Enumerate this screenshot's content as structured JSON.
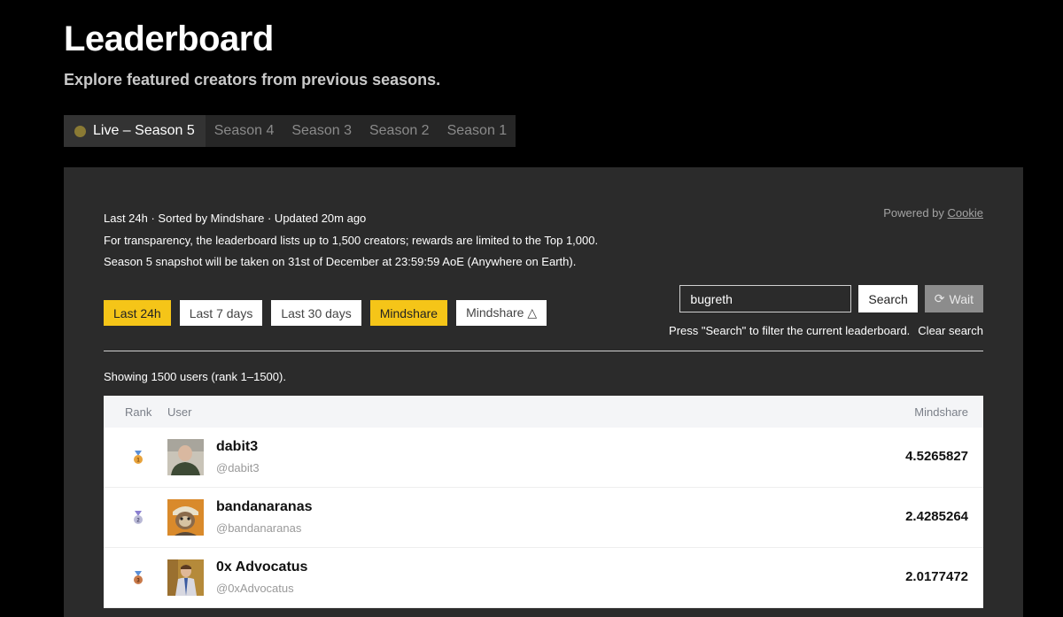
{
  "header": {
    "title": "Leaderboard",
    "subtitle": "Explore featured creators from previous seasons."
  },
  "season_tabs": [
    {
      "label": "Live – Season 5",
      "active": true
    },
    {
      "label": "Season 4",
      "active": false
    },
    {
      "label": "Season 3",
      "active": false
    },
    {
      "label": "Season 2",
      "active": false
    },
    {
      "label": "Season 1",
      "active": false
    }
  ],
  "info": {
    "line1": "Last 24h · Sorted by Mindshare · Updated 20m ago",
    "line2": "For transparency, the leaderboard lists up to 1,500 creators; rewards are limited to the Top 1,000.",
    "line3": "Season 5 snapshot will be taken on 31st of December at 23:59:59 AoE (Anywhere on Earth).",
    "powered_by_prefix": "Powered by",
    "powered_by_link": "Cookie"
  },
  "filters": [
    {
      "label": "Last 24h",
      "active": true
    },
    {
      "label": "Last 7 days",
      "active": false
    },
    {
      "label": "Last 30 days",
      "active": false
    },
    {
      "label": "Mindshare",
      "active": true
    },
    {
      "label": "Mindshare △",
      "active": false
    }
  ],
  "search": {
    "value": "bugreth",
    "button_label": "Search",
    "wait_label": "Wait",
    "hint": "Press \"Search\" to filter the current leaderboard.",
    "clear_label": "Clear search"
  },
  "showing_text": "Showing 1500 users (rank 1–1500).",
  "table": {
    "headers": {
      "rank": "Rank",
      "user": "User",
      "mindshare": "Mindshare"
    },
    "rows": [
      {
        "rank": 1,
        "medal_label": "1",
        "medal_color": "#e8a33c",
        "ribbon_color": "#5b8fd6",
        "name": "dabit3",
        "handle": "@dabit3",
        "mindshare": "4.5265827",
        "avatar_icon": "person-avatar-icon"
      },
      {
        "rank": 2,
        "medal_label": "2",
        "medal_color": "#b9b9d6",
        "ribbon_color": "#8a7fd0",
        "name": "bandanaranas",
        "handle": "@bandanaranas",
        "mindshare": "2.4285264",
        "avatar_icon": "sloth-avatar-icon"
      },
      {
        "rank": 3,
        "medal_label": "3",
        "medal_color": "#c97a4a",
        "ribbon_color": "#5b8fd6",
        "name": "0x Advocatus",
        "handle": "@0xAdvocatus",
        "mindshare": "2.0177472",
        "avatar_icon": "suit-avatar-icon"
      }
    ]
  },
  "colors": {
    "accent_yellow": "#f5c518",
    "panel_bg": "#2b2b2b",
    "page_bg": "#000000",
    "live_dot": "#8a7a34"
  }
}
